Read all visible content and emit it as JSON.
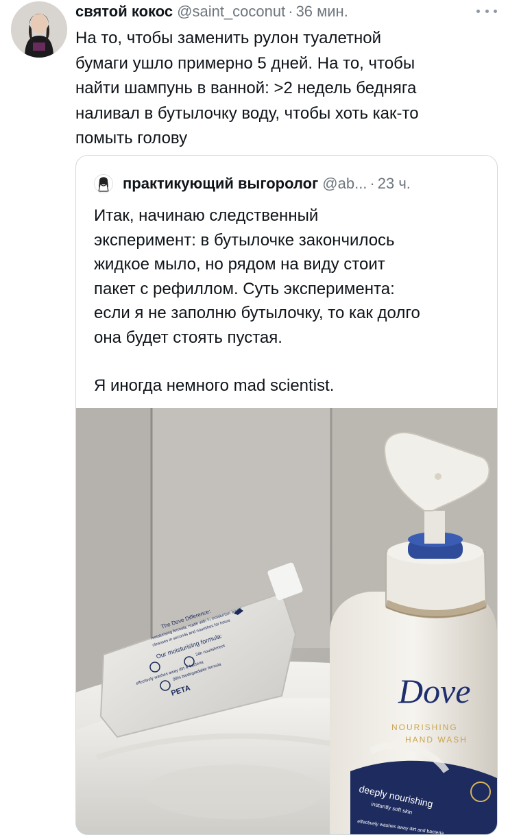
{
  "tweet": {
    "display_name": "святой кокос",
    "handle": "@saint_coconut",
    "separator": "·",
    "time": "36 мин.",
    "text": "На то, чтобы заменить рулон туалетной\nбумаги ушло примерно 5 дней. На то, чтобы\nнайти шампунь в ванной: >2 недель бедняга\nналивал в бутылочку воду, чтобы хоть как-то\nпомыть голову"
  },
  "quote": {
    "display_name": "практикующий выгоролог",
    "handle": "@ab...",
    "separator": "·",
    "time": "23 ч.",
    "paragraph1": "Итак, начинаю следственный\nэксперимент: в бутылочке закончилось\nжидкое мыло, но рядом на виду стоит\nпакет с рефиллом. Суть эксперимента:\nесли я не заполню бутылочку, то как долго\nона будет стоять пустая.",
    "paragraph2": "Я иногда немного mad scientist."
  },
  "photo": {
    "pouch": {
      "title": "The Dove Difference:",
      "line1": "moisturising formula, made with ¼ moisturiser blend",
      "line2": "cleanses in seconds and nourishes for hours",
      "formula": "Our moisturising formula:",
      "badge1": "effectively washes away dirt & bacteria",
      "badge2": "24h nourishment",
      "badge3": "99% biodegradable formula",
      "peta": "PETA"
    },
    "bottle": {
      "brand": "Dove",
      "sub1": "NOURISHING",
      "sub2": "HAND WASH",
      "tag1": "deeply nourishing",
      "tag2": "instantly soft skin",
      "tag3": "effectively washes away dirt and bacteria"
    }
  },
  "colors": {
    "text": "#0f1419",
    "secondary": "#6e767d",
    "border": "#cfd9de"
  },
  "icons": [
    "more-icon"
  ]
}
